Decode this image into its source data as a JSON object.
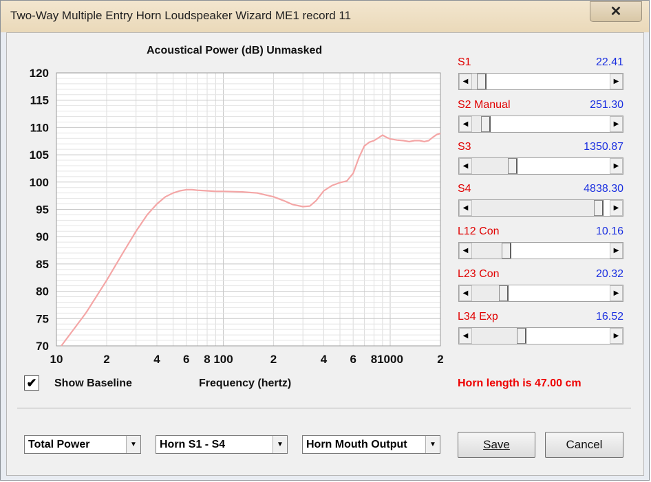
{
  "window": {
    "title": "Two-Way Multiple Entry Horn Loudspeaker Wizard   ME1 record 11",
    "close_glyph": "✕"
  },
  "chart": {
    "title": "Acoustical Power (dB)   Unmasked"
  },
  "chart_data": {
    "type": "line",
    "title": "Acoustical Power (dB)   Unmasked",
    "xlabel": "Frequency (hertz)",
    "ylabel": "",
    "x_scale": "log",
    "xlim": [
      10,
      2000
    ],
    "ylim": [
      70,
      120
    ],
    "x_ticks": [
      10,
      20,
      40,
      60,
      80,
      100,
      200,
      400,
      600,
      800,
      1000,
      2000
    ],
    "x_tick_labels": [
      "10",
      "2",
      "4",
      "6",
      "8",
      "100",
      "2",
      "4",
      "6",
      "8",
      "1000",
      "2"
    ],
    "y_ticks": [
      70,
      75,
      80,
      85,
      90,
      95,
      100,
      105,
      110,
      115,
      120
    ],
    "y_tick_labels": [
      "70",
      "75",
      "80",
      "85",
      "90",
      "95",
      "100",
      "105",
      "110",
      "115",
      "120"
    ],
    "grid": true,
    "line_color": "#f4a6a6",
    "x": [
      10.7,
      15,
      20,
      25,
      30,
      35,
      40,
      45,
      50,
      55,
      60,
      65,
      70,
      80,
      90,
      100,
      130,
      160,
      200,
      230,
      260,
      300,
      330,
      360,
      400,
      450,
      500,
      550,
      600,
      650,
      700,
      750,
      800,
      850,
      900,
      950,
      1000,
      1100,
      1200,
      1300,
      1400,
      1500,
      1600,
      1700,
      1800,
      1900,
      2000
    ],
    "y": [
      70,
      76,
      82,
      87,
      91,
      94,
      96,
      97.3,
      98.0,
      98.4,
      98.6,
      98.6,
      98.5,
      98.4,
      98.3,
      98.3,
      98.2,
      98.0,
      97.3,
      96.6,
      95.9,
      95.5,
      95.6,
      96.6,
      98.4,
      99.4,
      99.9,
      100.2,
      101.6,
      104.5,
      106.6,
      107.3,
      107.6,
      108.1,
      108.6,
      108.2,
      107.9,
      107.7,
      107.6,
      107.4,
      107.6,
      107.6,
      107.4,
      107.6,
      108.2,
      108.7,
      108.9
    ]
  },
  "sliders": [
    {
      "label": "S1",
      "value": "22.41",
      "position": 0.04
    },
    {
      "label": "S2  Manual",
      "value": "251.30",
      "position": 0.07
    },
    {
      "label": "S3",
      "value": "1350.87",
      "position": 0.28
    },
    {
      "label": "S4",
      "value": "4838.30",
      "position": 0.95
    },
    {
      "label": "L12  Con",
      "value": "10.16",
      "position": 0.23
    },
    {
      "label": "L23  Con",
      "value": "20.32",
      "position": 0.21
    },
    {
      "label": "L34  Exp",
      "value": "16.52",
      "position": 0.35
    }
  ],
  "show_baseline": {
    "label": "Show Baseline",
    "checked": true,
    "check_glyph": "✔"
  },
  "x_axis_label": "Frequency (hertz)",
  "horn_length": "Horn length is 47.00 cm",
  "dropdowns": {
    "output_type": "Total Power",
    "horn_section": "Horn S1 - S4",
    "output_point": "Horn Mouth Output"
  },
  "buttons": {
    "save": "Save",
    "cancel": "Cancel"
  },
  "glyphs": {
    "left_arrow": "◀",
    "right_arrow": "▶",
    "down_arrow": "▼"
  }
}
